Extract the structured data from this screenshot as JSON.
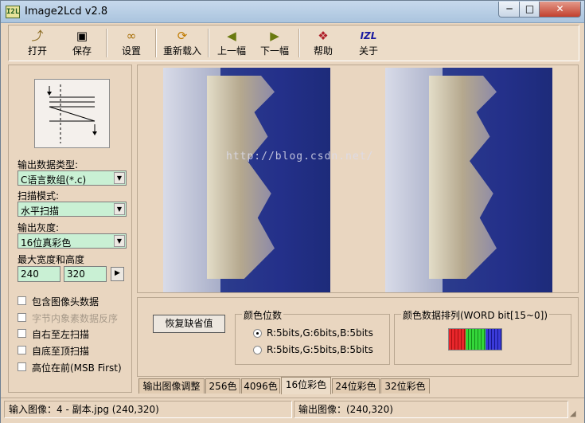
{
  "window": {
    "title": "Image2Lcd v2.8",
    "icon_text": "I2L",
    "min_label": "─",
    "max_label": "□",
    "close_label": "✕"
  },
  "toolbar": [
    {
      "label": "打开",
      "icon": "open-folder-icon",
      "glyph": "📂"
    },
    {
      "label": "保存",
      "icon": "save-disk-icon",
      "glyph": "💾"
    },
    {
      "label": "设置",
      "icon": "settings-glasses-icon",
      "glyph": "👓"
    },
    {
      "label": "重新载入",
      "icon": "reload-icon",
      "glyph": "🔄"
    },
    {
      "label": "上一幅",
      "icon": "arrow-left-icon",
      "glyph": "⬅"
    },
    {
      "label": "下一幅",
      "icon": "arrow-right-icon",
      "glyph": "➡"
    },
    {
      "label": "帮助",
      "icon": "help-book-icon",
      "glyph": "📕"
    },
    {
      "label": "关于",
      "icon": "about-logo-icon",
      "glyph": "IZL"
    }
  ],
  "left": {
    "output_type_label": "输出数据类型:",
    "output_type_value": "C语言数组(*.c)",
    "scan_mode_label": "扫描模式:",
    "scan_mode_value": "水平扫描",
    "gray_label": "输出灰度:",
    "gray_value": "16位真彩色",
    "size_label": "最大宽度和高度",
    "width_value": "240",
    "height_value": "320",
    "play_label": "▶",
    "checkboxes": [
      {
        "label": "包含图像头数据",
        "enabled": true
      },
      {
        "label": "字节内象素数据反序",
        "enabled": false
      },
      {
        "label": "自右至左扫描",
        "enabled": true
      },
      {
        "label": "自底至顶扫描",
        "enabled": true
      },
      {
        "label": "高位在前(MSB First)",
        "enabled": true
      }
    ]
  },
  "preview": {
    "watermark": "http://blog.csdn.net/"
  },
  "controls": {
    "restore_label": "恢复缺省值",
    "color_bits_title": "颜色位数",
    "radio1": "R:5bits,G:6bits,B:5bits",
    "radio2": "R:5bits,G:5bits,B:5bits",
    "arrange_title": "颜色数据排列(WORD bit[15~0])",
    "swatch_colors": [
      "#e8262b",
      "#34d63a",
      "#3a3ad8"
    ]
  },
  "tabs": [
    "输出图像调整",
    "256色",
    "4096色",
    "16位彩色",
    "24位彩色",
    "32位彩色"
  ],
  "active_tab": 3,
  "status": {
    "input": "输入图像：4 - 副本.jpg (240,320)",
    "output": "输出图像：(240,320)"
  }
}
